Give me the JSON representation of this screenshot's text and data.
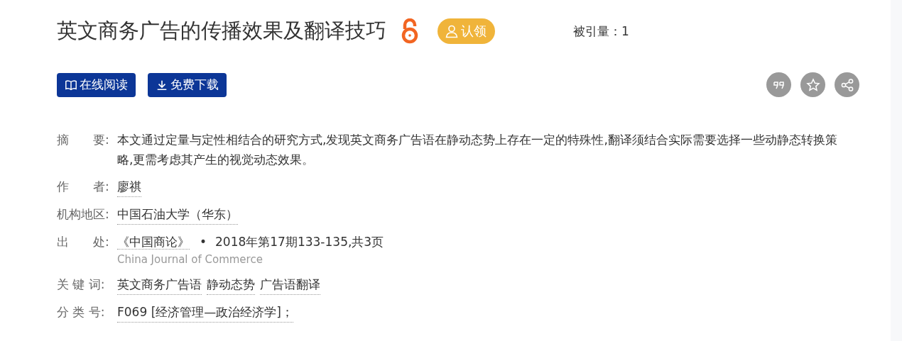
{
  "title": "英文商务广告的传播效果及翻译技巧",
  "open_access": true,
  "claim_button": "认领",
  "citations": "被引量：1",
  "actions": [
    {
      "kind": "read",
      "label": "在线阅读"
    },
    {
      "kind": "download",
      "label": "免费下载"
    }
  ],
  "tools": [
    {
      "kind": "quote"
    },
    {
      "kind": "star"
    },
    {
      "kind": "share"
    }
  ],
  "fields": [
    {
      "label": "摘　　要:",
      "kind": "text",
      "value": "本文通过定量与定性相结合的研究方式,发现英文商务广告语在静动态势上存在一定的特殊性,翻译须结合实际需要选择一些动静态转换策略,更需考虑其产生的视觉动态效果。"
    },
    {
      "label": "作　　者:",
      "kind": "links",
      "links": [
        "廖祺"
      ]
    },
    {
      "label": "机构地区:",
      "kind": "links",
      "links": [
        "中国石油大学（华东）"
      ]
    },
    {
      "label": "出　　处:",
      "kind": "source",
      "journal": "《中国商论》",
      "separator": "•",
      "issue": "2018年第17期133-135,共3页",
      "journal_en": "China Journal of Commerce"
    },
    {
      "label": "关 键 词:",
      "kind": "links",
      "links": [
        "英文商务广告语",
        "静动态势",
        "广告语翻译"
      ]
    },
    {
      "label": "分 类 号:",
      "kind": "links",
      "links": [
        "F069 [经济管理—政治经济学]；"
      ]
    }
  ]
}
